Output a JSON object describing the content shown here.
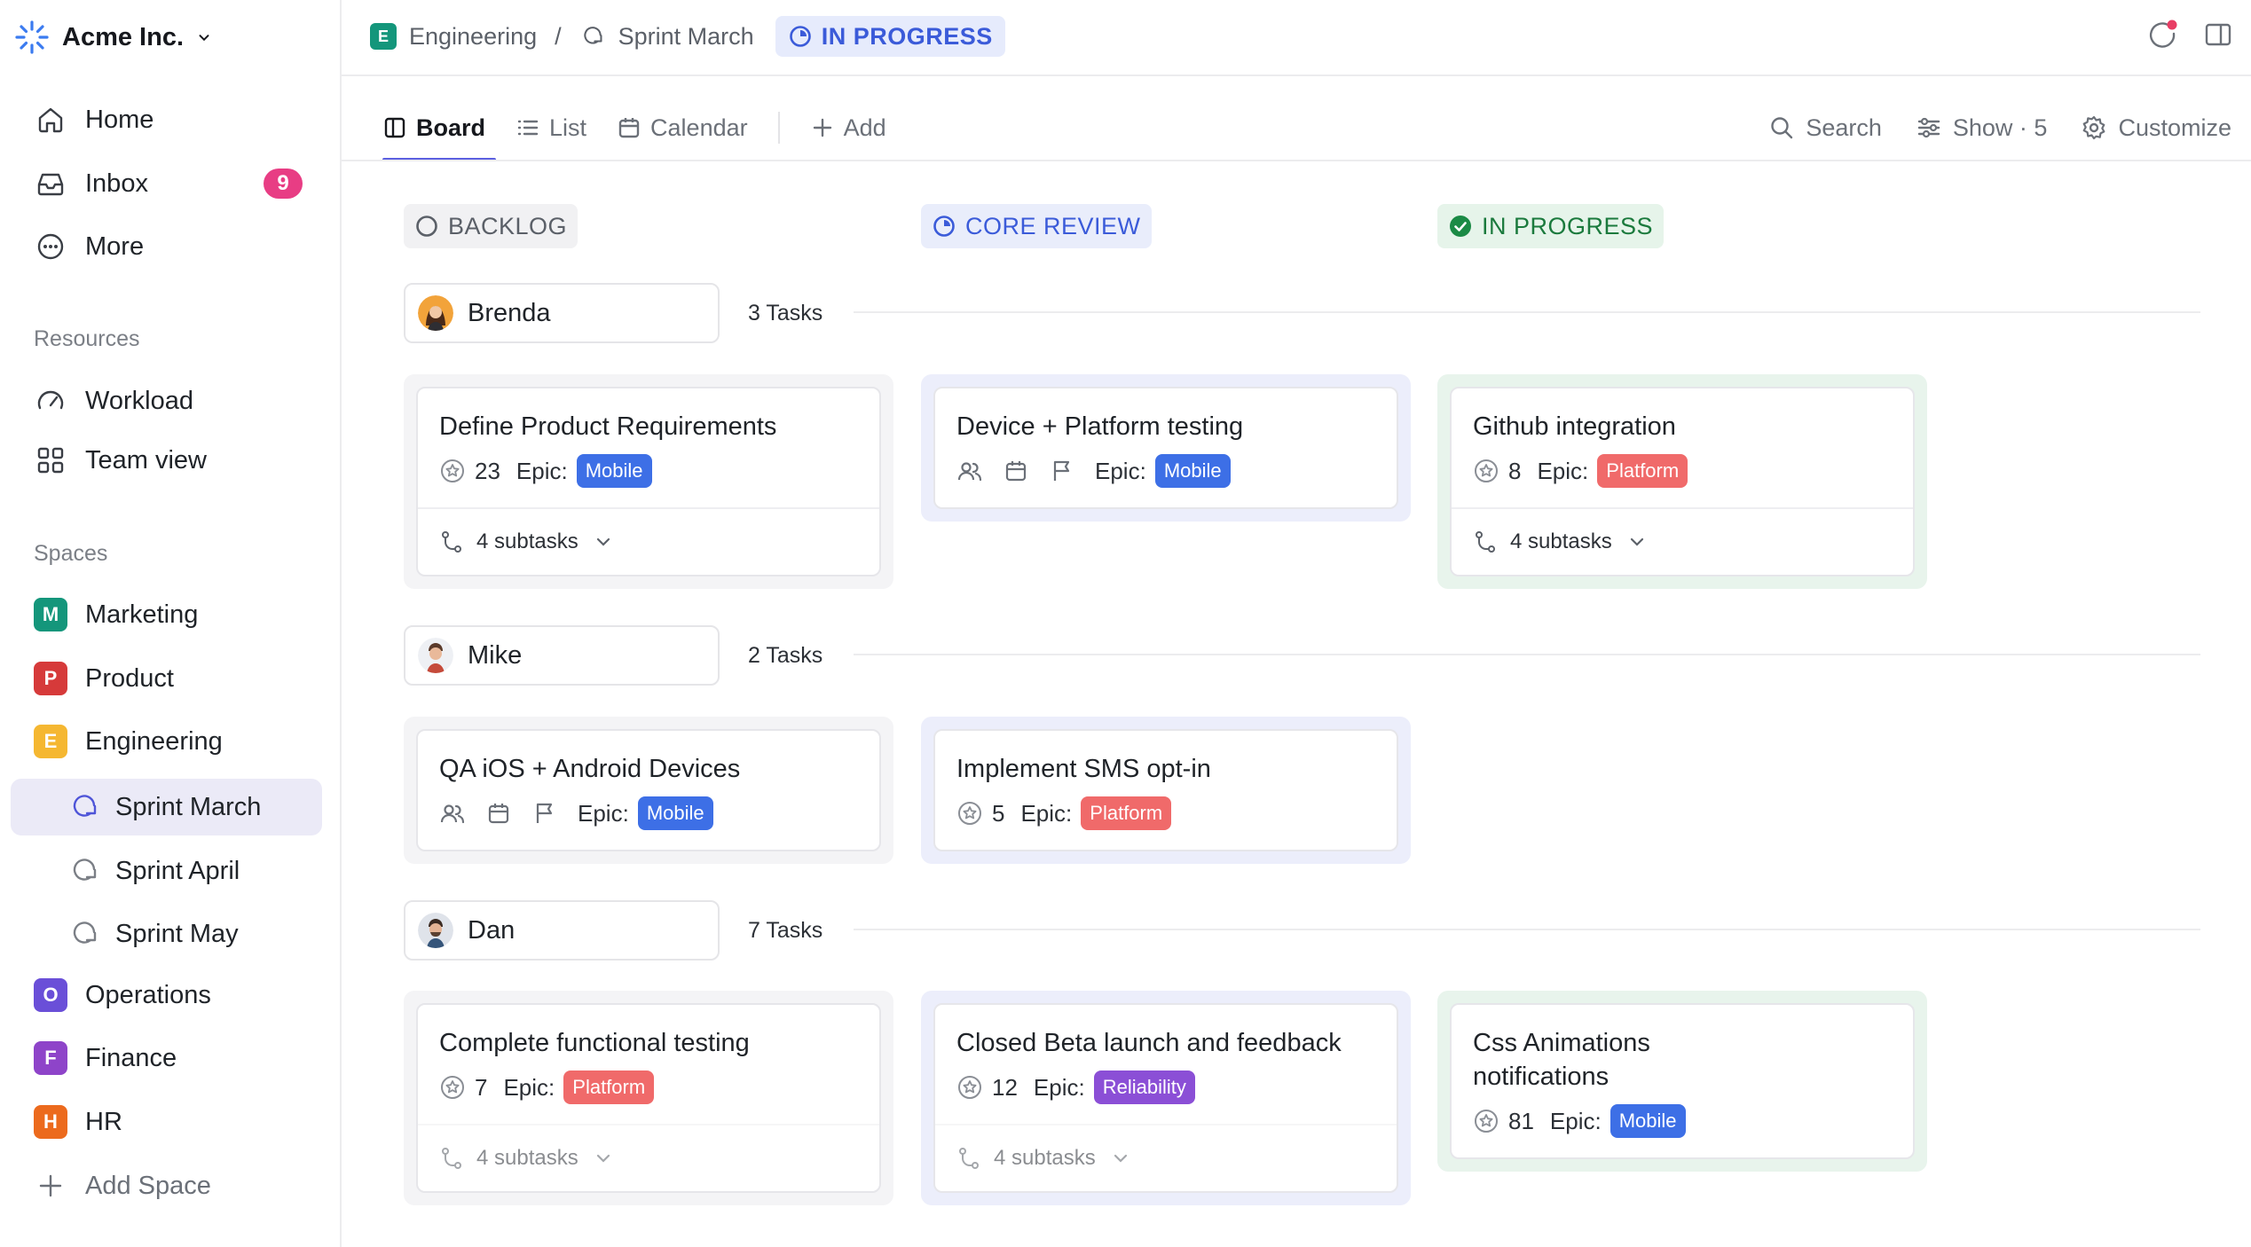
{
  "workspace": {
    "name": "Acme Inc."
  },
  "nav": {
    "home": "Home",
    "inbox": "Inbox",
    "inbox_count": "9",
    "more": "More"
  },
  "resources": {
    "label": "Resources",
    "workload": "Workload",
    "team_view": "Team view"
  },
  "spaces": {
    "label": "Spaces",
    "items": [
      {
        "letter": "M",
        "name": "Marketing",
        "color": "#14967b"
      },
      {
        "letter": "P",
        "name": "Product",
        "color": "#d63a3a"
      },
      {
        "letter": "E",
        "name": "Engineering",
        "color": "#f5b731"
      },
      {
        "letter": "O",
        "name": "Operations",
        "color": "#6a4fd8"
      },
      {
        "letter": "F",
        "name": "Finance",
        "color": "#8e44c9"
      },
      {
        "letter": "H",
        "name": "HR",
        "color": "#ec6a1d"
      }
    ],
    "sprints": [
      "Sprint March",
      "Sprint April",
      "Sprint May"
    ],
    "add": "Add Space"
  },
  "breadcrumb": {
    "space_letter": "E",
    "space": "Engineering",
    "separator": "/",
    "list": "Sprint March",
    "status": "IN PROGRESS"
  },
  "tabs": {
    "board": "Board",
    "list": "List",
    "calendar": "Calendar",
    "add": "Add",
    "search": "Search",
    "show": "Show · 5",
    "customize": "Customize"
  },
  "columns": [
    {
      "name": "BACKLOG",
      "color": "#5b6068",
      "bg": "#f1f1f3"
    },
    {
      "name": "CORE REVIEW",
      "color": "#3b5bd9",
      "bg": "#e9edfb"
    },
    {
      "name": "IN PROGRESS",
      "color": "#1b7a3d",
      "bg": "#e6f4ea"
    }
  ],
  "groups": [
    {
      "name": "Brenda",
      "count": "3 Tasks",
      "cards": [
        {
          "title": "Define Product Requirements",
          "points": "23",
          "epic_label": "Epic:",
          "epic": "Mobile",
          "subtasks": "4 subtasks"
        },
        {
          "title": "Device + Platform testing",
          "epic_label": "Epic:",
          "epic": "Mobile"
        },
        {
          "title": "Github integration",
          "points": "8",
          "epic_label": "Epic:",
          "epic": "Platform",
          "subtasks": "4 subtasks"
        }
      ]
    },
    {
      "name": "Mike",
      "count": "2 Tasks",
      "cards": [
        {
          "title": "QA iOS + Android Devices",
          "epic_label": "Epic:",
          "epic": "Mobile"
        },
        {
          "title": "Implement SMS opt-in",
          "points": "5",
          "epic_label": "Epic:",
          "epic": "Platform"
        }
      ]
    },
    {
      "name": "Dan",
      "count": "7 Tasks",
      "cards": [
        {
          "title": "Complete functional testing",
          "points": "7",
          "epic_label": "Epic:",
          "epic": "Platform",
          "subtasks": "4 subtasks"
        },
        {
          "title": "Closed Beta launch and feedback",
          "points": "12",
          "epic_label": "Epic:",
          "epic": "Reliability",
          "subtasks": "4 subtasks"
        },
        {
          "title_line1": "Css Animations",
          "title_line2": "notifications",
          "points": "81",
          "epic_label": "Epic:",
          "epic": "Mobile"
        }
      ]
    }
  ],
  "tag_colors": {
    "Mobile": "#3d6fe6",
    "Platform": "#f06a6a",
    "Reliability": "#8b4fd6"
  }
}
